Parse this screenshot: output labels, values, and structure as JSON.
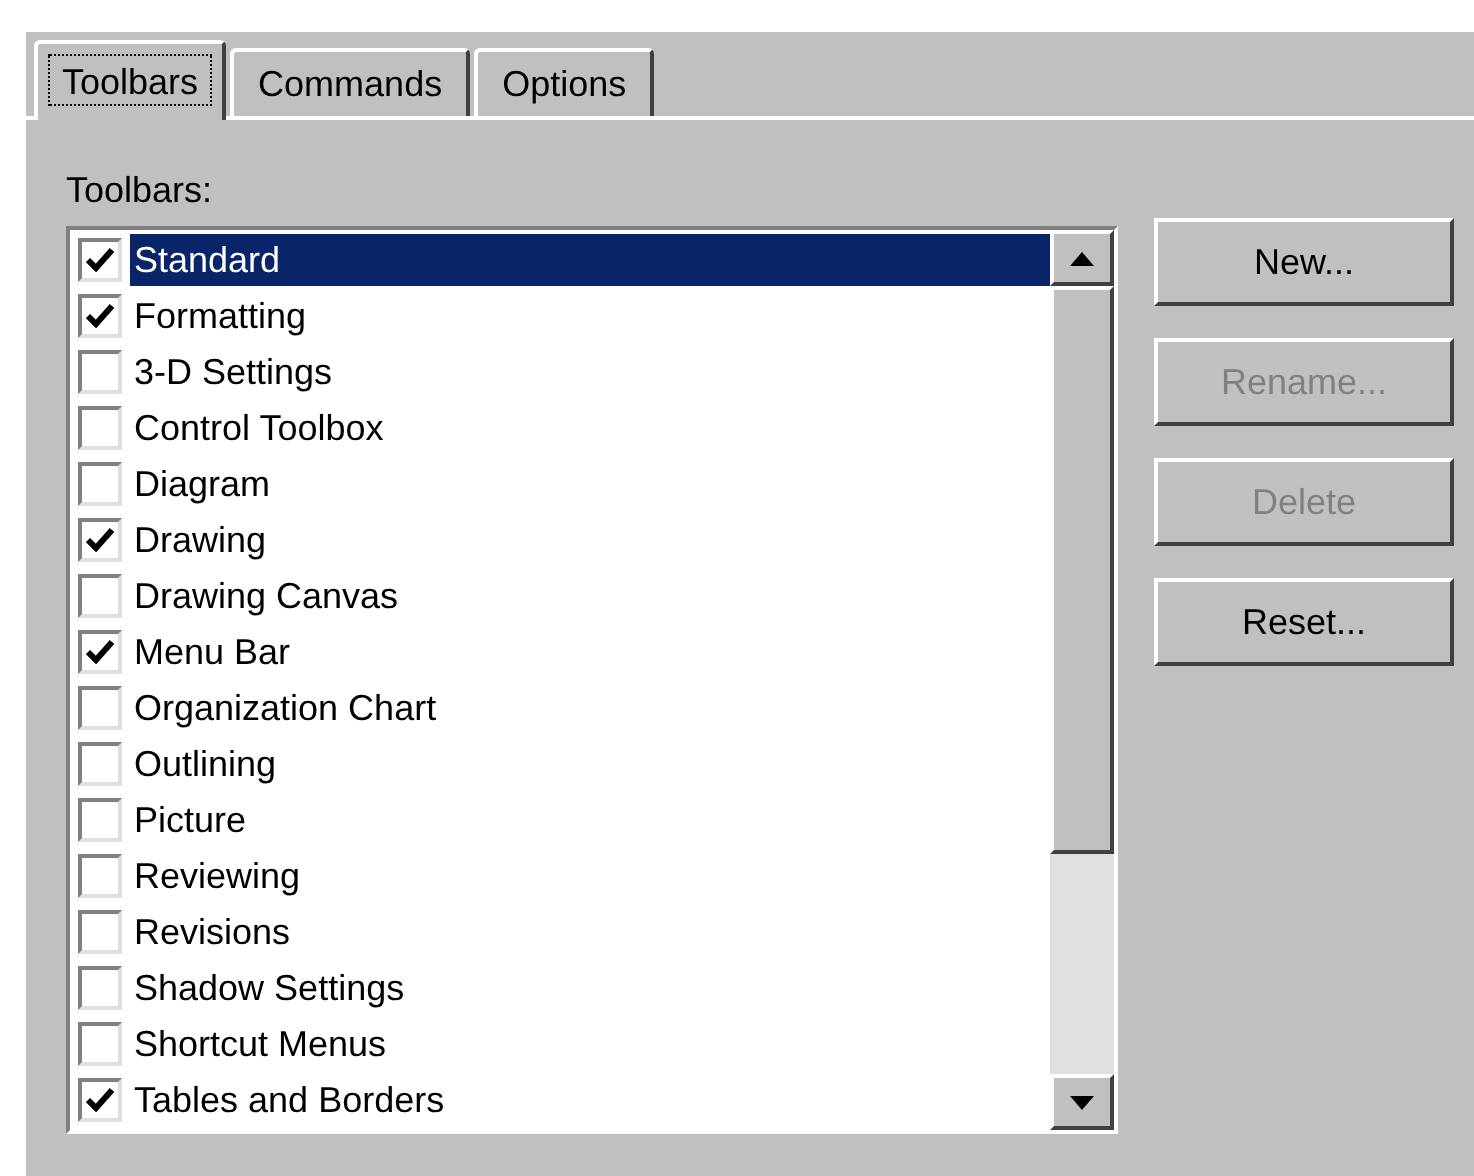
{
  "tabs": [
    {
      "label": "Toolbars",
      "selected": true
    },
    {
      "label": "Commands",
      "selected": false
    },
    {
      "label": "Options",
      "selected": false
    }
  ],
  "list_label": "Toolbars:",
  "toolbars": [
    {
      "label": "Standard",
      "checked": true,
      "selected": true
    },
    {
      "label": "Formatting",
      "checked": true,
      "selected": false
    },
    {
      "label": "3-D Settings",
      "checked": false,
      "selected": false
    },
    {
      "label": "Control Toolbox",
      "checked": false,
      "selected": false
    },
    {
      "label": "Diagram",
      "checked": false,
      "selected": false
    },
    {
      "label": "Drawing",
      "checked": true,
      "selected": false
    },
    {
      "label": "Drawing Canvas",
      "checked": false,
      "selected": false
    },
    {
      "label": "Menu Bar",
      "checked": true,
      "selected": false
    },
    {
      "label": "Organization Chart",
      "checked": false,
      "selected": false
    },
    {
      "label": "Outlining",
      "checked": false,
      "selected": false
    },
    {
      "label": "Picture",
      "checked": false,
      "selected": false
    },
    {
      "label": "Reviewing",
      "checked": false,
      "selected": false
    },
    {
      "label": "Revisions",
      "checked": false,
      "selected": false
    },
    {
      "label": "Shadow Settings",
      "checked": false,
      "selected": false
    },
    {
      "label": "Shortcut Menus",
      "checked": false,
      "selected": false
    },
    {
      "label": "Tables and Borders",
      "checked": true,
      "selected": false
    }
  ],
  "buttons": [
    {
      "label": "New...",
      "disabled": false
    },
    {
      "label": "Rename...",
      "disabled": true
    },
    {
      "label": "Delete",
      "disabled": true
    },
    {
      "label": "Reset...",
      "disabled": false
    }
  ]
}
